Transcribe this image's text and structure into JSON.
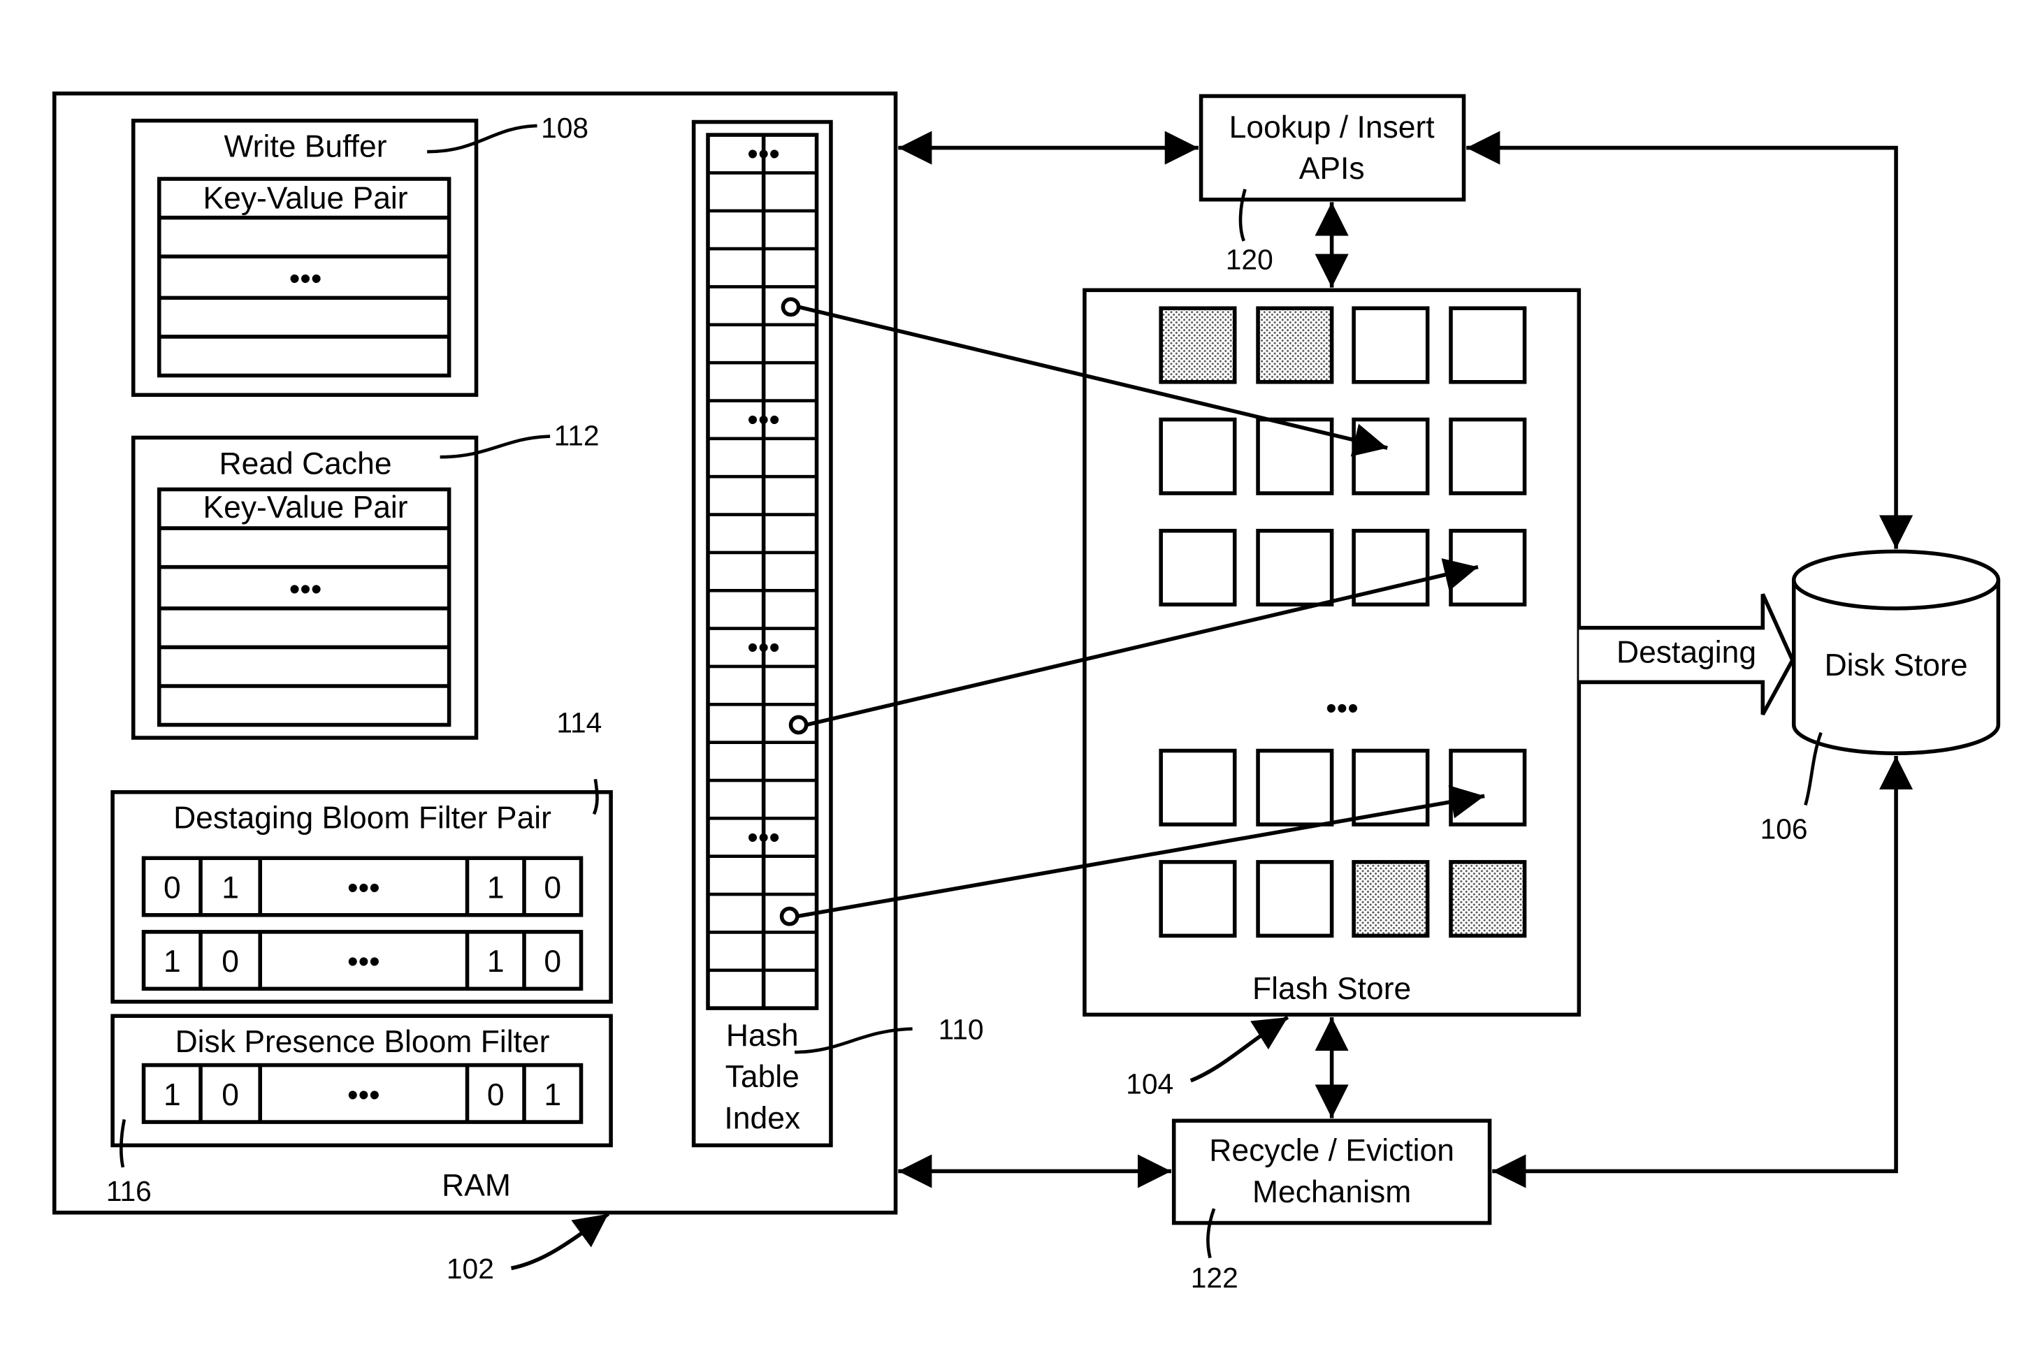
{
  "ram": {
    "label": "RAM",
    "ref": "102",
    "write_buffer": {
      "title": "Write Buffer",
      "ref": "108",
      "header": "Key-Value Pair",
      "ellipsis": "•••"
    },
    "read_cache": {
      "title": "Read Cache",
      "ref": "112",
      "header": "Key-Value Pair",
      "ellipsis": "•••"
    },
    "destaging_bloom": {
      "title": "Destaging Bloom Filter Pair",
      "ref": "114",
      "rows": [
        [
          "0",
          "1",
          "•••",
          "1",
          "0"
        ],
        [
          "1",
          "0",
          "•••",
          "1",
          "0"
        ]
      ]
    },
    "disk_presence_bloom": {
      "title": "Disk Presence Bloom Filter",
      "ref": "116",
      "rows": [
        [
          "1",
          "0",
          "•••",
          "0",
          "1"
        ]
      ]
    },
    "hash_index": {
      "title_line1": "Hash",
      "title_line2": "Table",
      "title_line3": "Index",
      "ref": "110",
      "ellipsis": "•••"
    }
  },
  "lookup_api": {
    "line1": "Lookup / Insert",
    "line2": "APIs",
    "ref": "120"
  },
  "flash_store": {
    "label": "Flash Store",
    "ref": "104",
    "ellipsis": "•••"
  },
  "destaging_arrow": {
    "label": "Destaging"
  },
  "disk_store": {
    "label": "Disk Store",
    "ref": "106"
  },
  "recycle": {
    "line1": "Recycle / Eviction",
    "line2": "Mechanism",
    "ref": "122"
  }
}
